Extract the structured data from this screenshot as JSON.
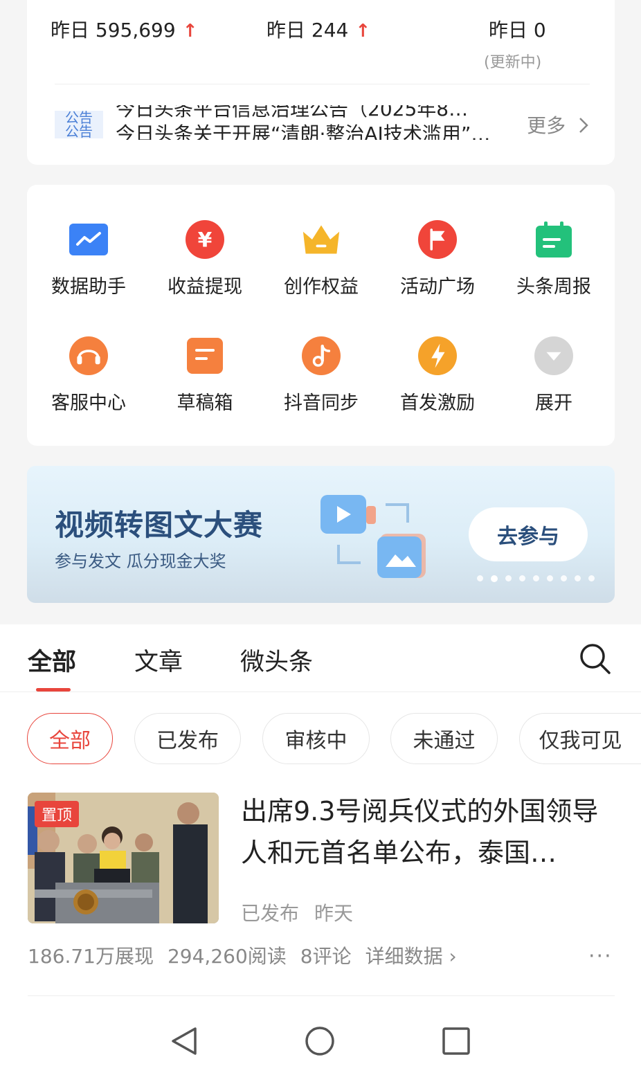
{
  "stats": [
    {
      "label": "昨日 595,699",
      "arrow": "↑"
    },
    {
      "label": "昨日 244",
      "arrow": "↑"
    },
    {
      "label": "昨日 0",
      "note": "(更新中)"
    }
  ],
  "notice": {
    "tag": [
      "公告",
      "公告"
    ],
    "line_top": "今日头条平台信息治理公告（2025年8…",
    "line_main": "今日头条关于开展“清朗·整治AI技术滥用”专项行动的公告",
    "more": "更多"
  },
  "tools": [
    {
      "label": "数据助手",
      "icon": "chart-icon",
      "color": "#3b82f6"
    },
    {
      "label": "收益提现",
      "icon": "yuan-icon",
      "color": "#f0453a"
    },
    {
      "label": "创作权益",
      "icon": "crown-icon",
      "color": "#f5b52a"
    },
    {
      "label": "活动广场",
      "icon": "flag-icon",
      "color": "#f0453a"
    },
    {
      "label": "头条周报",
      "icon": "calendar-icon",
      "color": "#23c17b"
    },
    {
      "label": "客服中心",
      "icon": "headset-icon",
      "color": "#f5803e"
    },
    {
      "label": "草稿箱",
      "icon": "draft-icon",
      "color": "#f5803e"
    },
    {
      "label": "抖音同步",
      "icon": "music-note-icon",
      "color": "#f5803e"
    },
    {
      "label": "首发激励",
      "icon": "lightning-icon",
      "color": "#f5a22a"
    },
    {
      "label": "展开",
      "icon": "expand-icon",
      "color": "#c8c8c8"
    }
  ],
  "banner": {
    "title": "视频转图文大赛",
    "subtitle": "参与发文 瓜分现金大奖",
    "button": "去参与"
  },
  "tabs": [
    "全部",
    "文章",
    "微头条"
  ],
  "filters": [
    "全部",
    "已发布",
    "审核中",
    "未通过",
    "仅我可见"
  ],
  "article": {
    "badge": "置顶",
    "title": "出席9.3号阅兵仪式的外国领导人和元首名单公布，泰国…",
    "status": "已发布",
    "time": "昨天",
    "impressions": "186.71万展现",
    "reads": "294,260阅读",
    "comments": "8评论",
    "details": "详细数据 ›",
    "more": "···"
  },
  "colors": {
    "accent": "#e8453c",
    "banner_text": "#2b4f7c"
  }
}
